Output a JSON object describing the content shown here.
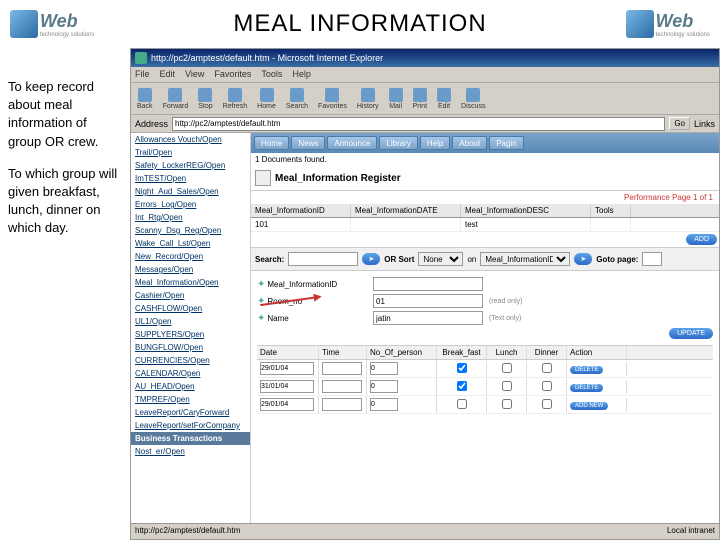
{
  "slide": {
    "title": "MEAL INFORMATION",
    "para1": "To keep record about meal information of group OR crew.",
    "para2": "To which group will given break­fast, lunch, dinner on which day.",
    "logo_text": "Web",
    "logo_sub": "technology solutions"
  },
  "ie": {
    "title": "http://pc2/amptest/default.htm - Microsoft Internet Explorer",
    "menu": [
      "File",
      "Edit",
      "View",
      "Favorites",
      "Tools",
      "Help"
    ],
    "toolbar": [
      "Back",
      "Forward",
      "Stop",
      "Refresh",
      "Home",
      "Search",
      "Favorites",
      "History",
      "Mail",
      "Print",
      "Edit",
      "Discuss"
    ],
    "address_label": "Address",
    "address_value": "http://pc2/amptest/default.htm",
    "go_label": "Go",
    "links_label": "Links"
  },
  "sidebar": {
    "items1": [
      "Allowances Vouch/Open",
      "Trail/Open",
      "Safety_LockerREG/Open",
      "ImTEST/Open",
      "Night_Aud_Sales/Open",
      "Errors_Log/Open",
      "Int_Rtg/Open",
      "Scanny_Dsg_Reg/Open",
      "Wake_Call_Lst/Open",
      "New_Record/Open",
      "Messages/Open",
      "Meal_Information/Open",
      "Cashier/Open",
      "CASHFLOW/Open",
      "UL1/Open",
      "SUPPLYERS/Open",
      "BUNGFLOW/Open",
      "CURRENCIES/Open",
      "CALENDAR/Open",
      "AU_HEAD/Open",
      "TMPREF/Open",
      "LeaveReport/CaryForward",
      "LeaveReport/setForCompany"
    ],
    "header": "Business Transactions",
    "items2": [
      "Nost_er/Open"
    ]
  },
  "topnav": [
    "Home",
    "News",
    "Announce",
    "Library",
    "Help",
    "About",
    "Pagin"
  ],
  "register": {
    "title": "Meal_Information Register",
    "docs_found": "1 Documents found.",
    "pager": "Performance Page 1 of 1",
    "grid_head": [
      "Meal_InformationID",
      "Meal_InformationDATE",
      "Meal_InformationDESC",
      "Tools"
    ],
    "grid_row": [
      "101",
      "",
      "test",
      ""
    ],
    "add_label": "ADD"
  },
  "search": {
    "search_label": "Search:",
    "or_label": "OR Sort",
    "sort_val": "None",
    "on_label": "on",
    "on_val": "Meal_InformationID",
    "goto_label": "Goto page:",
    "goto_val": ""
  },
  "form": {
    "f1_label": "Meal_InformationID",
    "f1_val": "",
    "f2_label": "Room_no",
    "f2_val": "01",
    "f2_hint": "(read only)",
    "f3_label": "Name",
    "f3_val": "jatin",
    "f3_hint": "(Text only)",
    "update_label": "UPDATE"
  },
  "table2": {
    "head": [
      "Date",
      "Time",
      "No_Of_person",
      "Break_fast",
      "Lunch",
      "Dinner",
      "Action"
    ],
    "rows": [
      {
        "date": "29/01/04",
        "time": "",
        "persons": "0",
        "bf": true,
        "lunch": false,
        "dinner": false,
        "action": "DELETE"
      },
      {
        "date": "31/01/04",
        "time": "",
        "persons": "0",
        "bf": true,
        "lunch": false,
        "dinner": false,
        "action": "DELETE"
      },
      {
        "date": "29/01/04",
        "time": "",
        "persons": "0",
        "bf": false,
        "lunch": false,
        "dinner": false,
        "action": "ADD NEW"
      }
    ]
  },
  "status": {
    "left": "http://pc2/amptest/default.htm",
    "right": "Local intranet"
  }
}
